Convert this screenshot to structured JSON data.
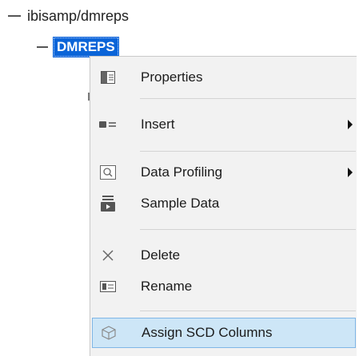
{
  "tree": {
    "root_label": "ibisamp/dmreps",
    "child_label": "DMREPS"
  },
  "context_menu": {
    "items": [
      {
        "label": "Properties",
        "icon": "properties-icon",
        "submenu": false
      },
      {
        "label": "Insert",
        "icon": "insert-icon",
        "submenu": true
      },
      {
        "label": "Data Profiling",
        "icon": "data-profiling-icon",
        "submenu": true
      },
      {
        "label": "Sample Data",
        "icon": "sample-data-icon",
        "submenu": false
      },
      {
        "label": "Delete",
        "icon": "delete-icon",
        "submenu": false
      },
      {
        "label": "Rename",
        "icon": "rename-icon",
        "submenu": false
      },
      {
        "label": "Assign SCD Columns",
        "icon": "assign-scd-columns-icon",
        "submenu": false,
        "highlighted": true
      }
    ]
  },
  "colors": {
    "selection": "#0a64d8",
    "menu_background": "#f2f2f2",
    "highlight": "#cde6f7",
    "highlight_border": "#7fb6e6"
  }
}
